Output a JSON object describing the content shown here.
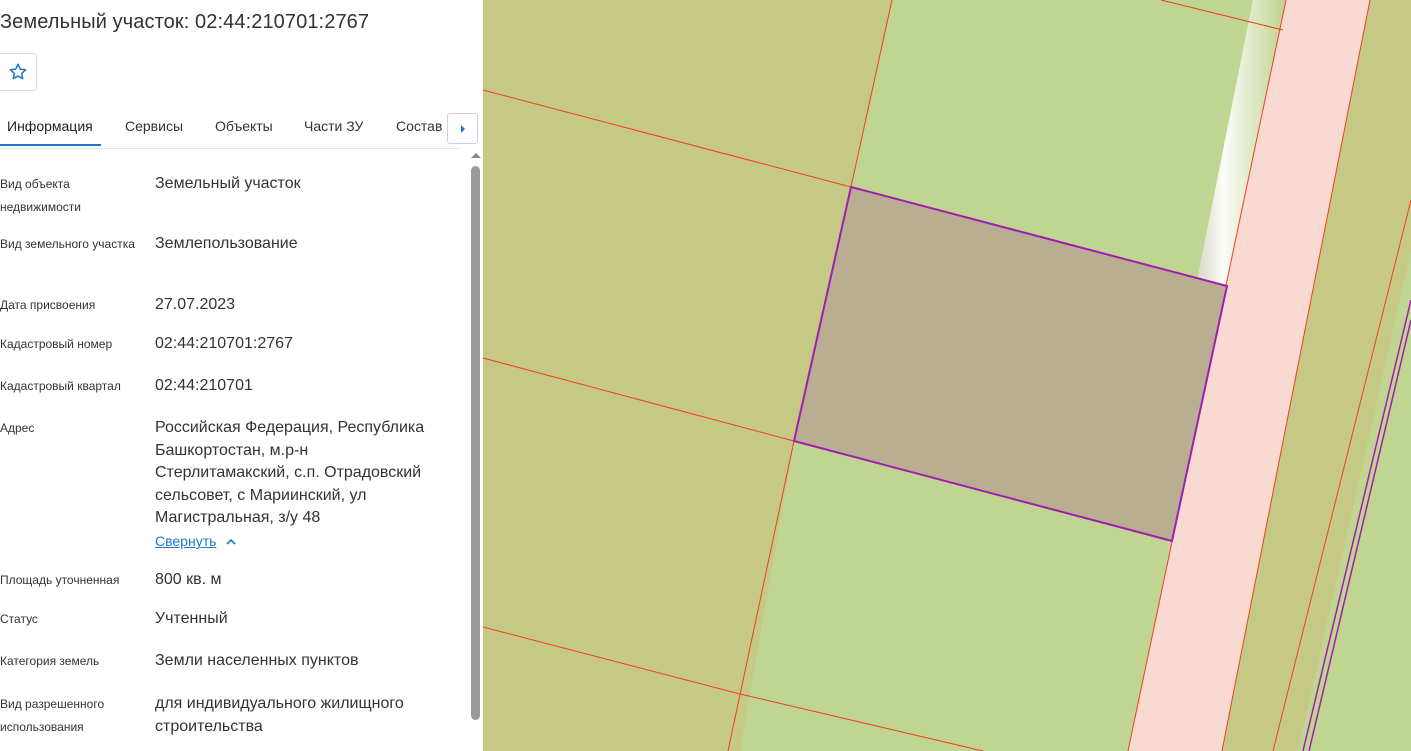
{
  "panel": {
    "title": "Земельный участок: 02:44:210701:2767",
    "favorite_icon": "star-outline-icon",
    "accent_color": "#1f78c9",
    "tabs": [
      {
        "label": "Информация",
        "active": true
      },
      {
        "label": "Сервисы",
        "active": false
      },
      {
        "label": "Объекты",
        "active": false
      },
      {
        "label": "Части ЗУ",
        "active": false
      },
      {
        "label": "Состав",
        "active": false
      }
    ],
    "tab_scroll_icon": "caret-right-icon",
    "fields": [
      {
        "label": "Вид объекта недвижимости",
        "value": "Земельный участок"
      },
      {
        "label": "Вид земельного участка",
        "value": "Землепользование"
      },
      {
        "label": "Дата присвоения",
        "value": "27.07.2023"
      },
      {
        "label": "Кадастровый номер",
        "value": "02:44:210701:2767"
      },
      {
        "label": "Кадастровый квартал",
        "value": "02:44:210701"
      },
      {
        "label": "Адрес",
        "value": "Российская Федерация, Республика Башкортостан, м.р-н Стерлитамакский, с.п. Отрадовский сельсовет, с Мариинский, ул Магистральная, з/у 48"
      },
      {
        "label": "Площадь уточненная",
        "value": "800 кв. м"
      },
      {
        "label": "Статус",
        "value": "Учтенный"
      },
      {
        "label": "Категория земель",
        "value": "Земли населенных пунктов"
      },
      {
        "label": "Вид разрешенного использования",
        "value": "для индивидуального жилищного строительства"
      }
    ],
    "collapse_label": "Свернуть",
    "collapse_icon": "chevron-up-icon"
  },
  "map": {
    "colors": {
      "parcel_fill_left": "#c6c885",
      "parcel_fill_right": "#c1d593",
      "selected_fill": "#b9ad92",
      "selected_border": "#a21cb0",
      "boundary_line": "#f0401c",
      "road_fill": "#f8dad2"
    }
  }
}
